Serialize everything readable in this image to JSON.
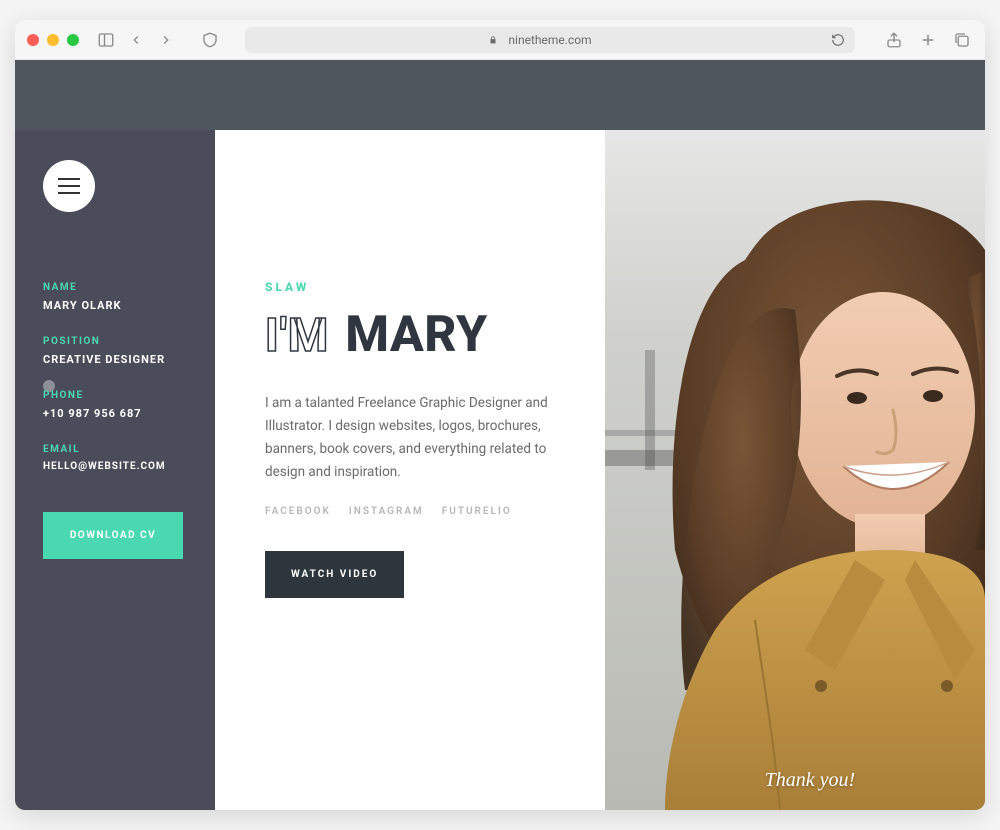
{
  "browser": {
    "url": "ninetheme.com"
  },
  "sidebar": {
    "name_label": "NAME",
    "name_value": "MARY OLARK",
    "position_label": "POSITION",
    "position_value": "CREATIVE DESIGNER",
    "phone_label": "PHONE",
    "phone_value": "+10 987 956 687",
    "email_label": "EMAIL",
    "email_value": "HELLO@WEBSITE.COM",
    "download_label": "DOWNLOAD CV"
  },
  "hero": {
    "eyebrow": "SLAW",
    "headline_outline": "I'M",
    "headline_solid": "MARY",
    "bio": "I am a talanted Freelance Graphic Designer and Illustrator. I design websites, logos, brochures, banners, book covers, and everything related to design and inspiration.",
    "socials": [
      "FACEBOOK",
      "INSTAGRAM",
      "FUTURELIO"
    ],
    "watch_label": "WATCH VIDEO",
    "thank_you": "Thank you!"
  },
  "colors": {
    "accent": "#4ad8b0",
    "sidebar_bg": "#4b4c5a",
    "topband": "#50565d",
    "headline": "#2f3640",
    "watch_btn": "#2e363d"
  }
}
